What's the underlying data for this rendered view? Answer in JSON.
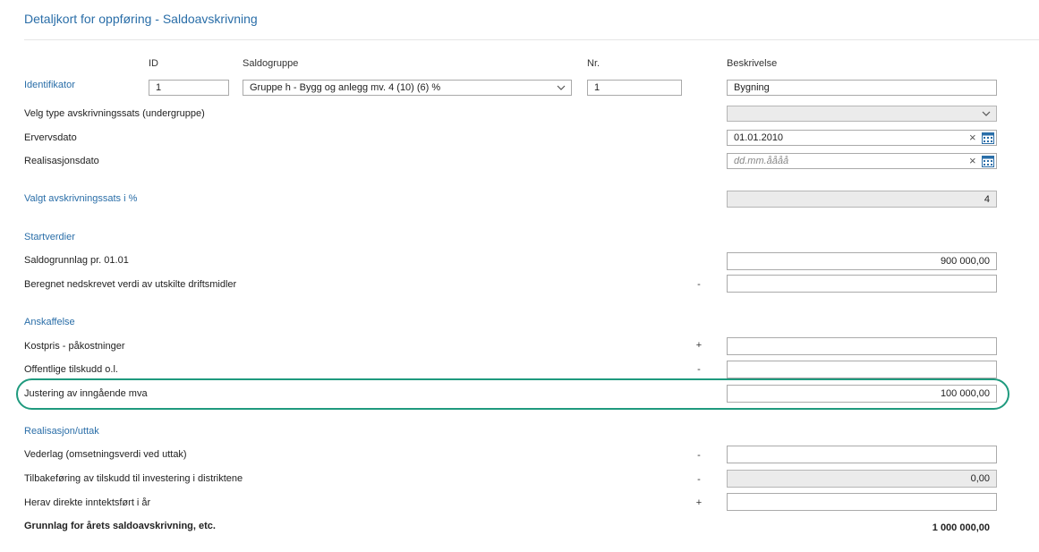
{
  "title": "Detaljkort for oppføring - Saldoavskrivning",
  "columns": {
    "id": "ID",
    "saldogruppe": "Saldogruppe",
    "nr": "Nr.",
    "beskrivelse": "Beskrivelse"
  },
  "identifikator": {
    "label": "Identifikator",
    "id_value": "1",
    "saldogruppe_value": "Gruppe h - Bygg og anlegg mv. 4 (10) (6) %",
    "nr_value": "1",
    "beskrivelse_value": "Bygning"
  },
  "undergruppe": {
    "label": "Velg type avskrivningssats (undergruppe)",
    "value": ""
  },
  "ervervsdato": {
    "label": "Ervervsdato",
    "value": "01.01.2010"
  },
  "realisasjonsdato": {
    "label": "Realisasjonsdato",
    "placeholder": "dd.mm.åååå"
  },
  "valgt_sats": {
    "label": "Valgt avskrivningssats i %",
    "value": "4"
  },
  "startverdier": {
    "heading": "Startverdier",
    "saldogrunnlag": {
      "label": "Saldogrunnlag pr. 01.01",
      "value": "900 000,00"
    },
    "nedskrevet": {
      "label": "Beregnet nedskrevet verdi av utskilte driftsmidler",
      "sign": "-",
      "value": ""
    }
  },
  "anskaffelse": {
    "heading": "Anskaffelse",
    "kostpris": {
      "label": "Kostpris - påkostninger",
      "sign": "+",
      "value": ""
    },
    "tilskudd": {
      "label": "Offentlige tilskudd o.l.",
      "sign": "-",
      "value": ""
    },
    "justering": {
      "label": "Justering av inngående mva",
      "value": "100 000,00"
    }
  },
  "realisasjon": {
    "heading": "Realisasjon/uttak",
    "vederlag": {
      "label": "Vederlag (omsetningsverdi ved uttak)",
      "sign": "-",
      "value": ""
    },
    "tilbakeforing": {
      "label": "Tilbakeføring av tilskudd til investering i distriktene",
      "sign": "-",
      "value": "0,00"
    },
    "herav": {
      "label": "Herav direkte inntektsført i år",
      "sign": "+",
      "value": ""
    }
  },
  "grunnlag": {
    "label": "Grunnlag for årets saldoavskrivning, etc.",
    "value": "1 000 000,00"
  },
  "colors": {
    "accent": "#2a6ea8",
    "highlight": "#1f9a7e"
  },
  "icons": {
    "dropdown": "chevron-down-icon",
    "clear": "close-icon",
    "calendar": "calendar-icon"
  }
}
